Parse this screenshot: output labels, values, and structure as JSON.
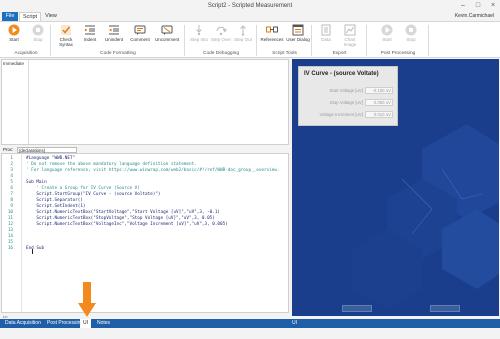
{
  "window": {
    "title": "Script2 - Scripted Measurement",
    "user": "Kevin.Carmichael"
  },
  "ribbon_tabs": [
    "File",
    "Script",
    "View"
  ],
  "ribbon": {
    "buttons": [
      {
        "label": "Start",
        "icon": "play-icon",
        "enabled": true
      },
      {
        "label": "Stop",
        "icon": "stop-icon",
        "enabled": false
      },
      {
        "label": "Check Syntax",
        "icon": "check-syntax-icon",
        "enabled": true
      },
      {
        "label": "Indent",
        "icon": "indent-icon",
        "enabled": true
      },
      {
        "label": "Unindent",
        "icon": "unindent-icon",
        "enabled": true
      },
      {
        "label": "Comment",
        "icon": "comment-icon",
        "enabled": true
      },
      {
        "label": "Uncomment",
        "icon": "uncomment-icon",
        "enabled": true
      },
      {
        "label": "Step Into",
        "icon": "step-into-icon",
        "enabled": false
      },
      {
        "label": "Step Over",
        "icon": "step-over-icon",
        "enabled": false
      },
      {
        "label": "Step Out",
        "icon": "step-out-icon",
        "enabled": false
      },
      {
        "label": "References",
        "icon": "references-icon",
        "enabled": true
      },
      {
        "label": "User Dialog",
        "icon": "user-dialog-icon",
        "enabled": true
      },
      {
        "label": "Data",
        "icon": "data-export-icon",
        "enabled": false
      },
      {
        "label": "Chart Image",
        "icon": "chart-image-icon",
        "enabled": false
      },
      {
        "label": "Start",
        "icon": "play-icon",
        "enabled": false
      },
      {
        "label": "Stop",
        "icon": "stop-icon",
        "enabled": false
      }
    ],
    "groups": [
      "Acquisition",
      "Code Formatting",
      "Code Debugging",
      "Script Tools",
      "Export",
      "Post Processing"
    ]
  },
  "immediate": {
    "label": "Immediate"
  },
  "procedure": {
    "label": "Proc:",
    "value": "(declarations)"
  },
  "editor": {
    "lines": [
      {
        "n": "1",
        "text": "#Language \"WWB.NET\"",
        "kind": "code"
      },
      {
        "n": "2",
        "text": "' Do not remove the above mandatory language definition statement.",
        "kind": "comment"
      },
      {
        "n": "3",
        "text": "' For language reference, visit https://www.winwrap.com/web2/basic/#!/ref/WWB-doc_group__overview.",
        "kind": "comment"
      },
      {
        "n": "4",
        "text": "",
        "kind": "code"
      },
      {
        "n": "5",
        "text": "Sub Main",
        "kind": "code"
      },
      {
        "n": "6",
        "text": "    ' Create a Group for IV Curve (Source V)",
        "kind": "comment"
      },
      {
        "n": "7",
        "text": "    Script.StartGroup(\"IV Curve - (source Voltate)\")",
        "kind": "code"
      },
      {
        "n": "8",
        "text": "    Script.Separator()",
        "kind": "code"
      },
      {
        "n": "9",
        "text": "    Script.SetIndent(1)",
        "kind": "code"
      },
      {
        "n": "10",
        "text": "    Script.NumericTextBox(\"StartVoltage\",\"Start Voltage [uV]\",\"uV\",3, -0.1)",
        "kind": "code"
      },
      {
        "n": "11",
        "text": "    Script.NumericTextBox(\"StopVoltage\",\"Stop Voltage [uV]\",\"uV\",3, 0.05)",
        "kind": "code"
      },
      {
        "n": "12",
        "text": "    Script.NumericTextBox(\"VoltageInc\",\"Voltage Increment [uV]\",\"uV\",3, 0.005)",
        "kind": "code"
      },
      {
        "n": "13",
        "text": "",
        "kind": "code"
      },
      {
        "n": "14",
        "text": "",
        "kind": "code"
      },
      {
        "n": "15",
        "text": "",
        "kind": "code"
      },
      {
        "n": "16",
        "text": "End Sub",
        "kind": "code"
      }
    ],
    "status": "Ln"
  },
  "bottom_tabs": [
    "Data Acquisition",
    "Post Processing",
    "UI",
    "Notes"
  ],
  "right_tab": "UI",
  "ui_preview": {
    "title": "IV Curve - (source Voltate)",
    "fields": [
      {
        "label": "Start Voltage [uV]",
        "value": "-0.100 uV"
      },
      {
        "label": "Stop Voltage [uV]",
        "value": "0.050 uV"
      },
      {
        "label": "Voltage Increment [uV]",
        "value": "0.010 uV"
      }
    ]
  },
  "colors": {
    "accent": "#1f6fbf",
    "tabbar": "#1f5fa8",
    "arrow": "#f28a1e",
    "pane": "#1a3d8c"
  }
}
